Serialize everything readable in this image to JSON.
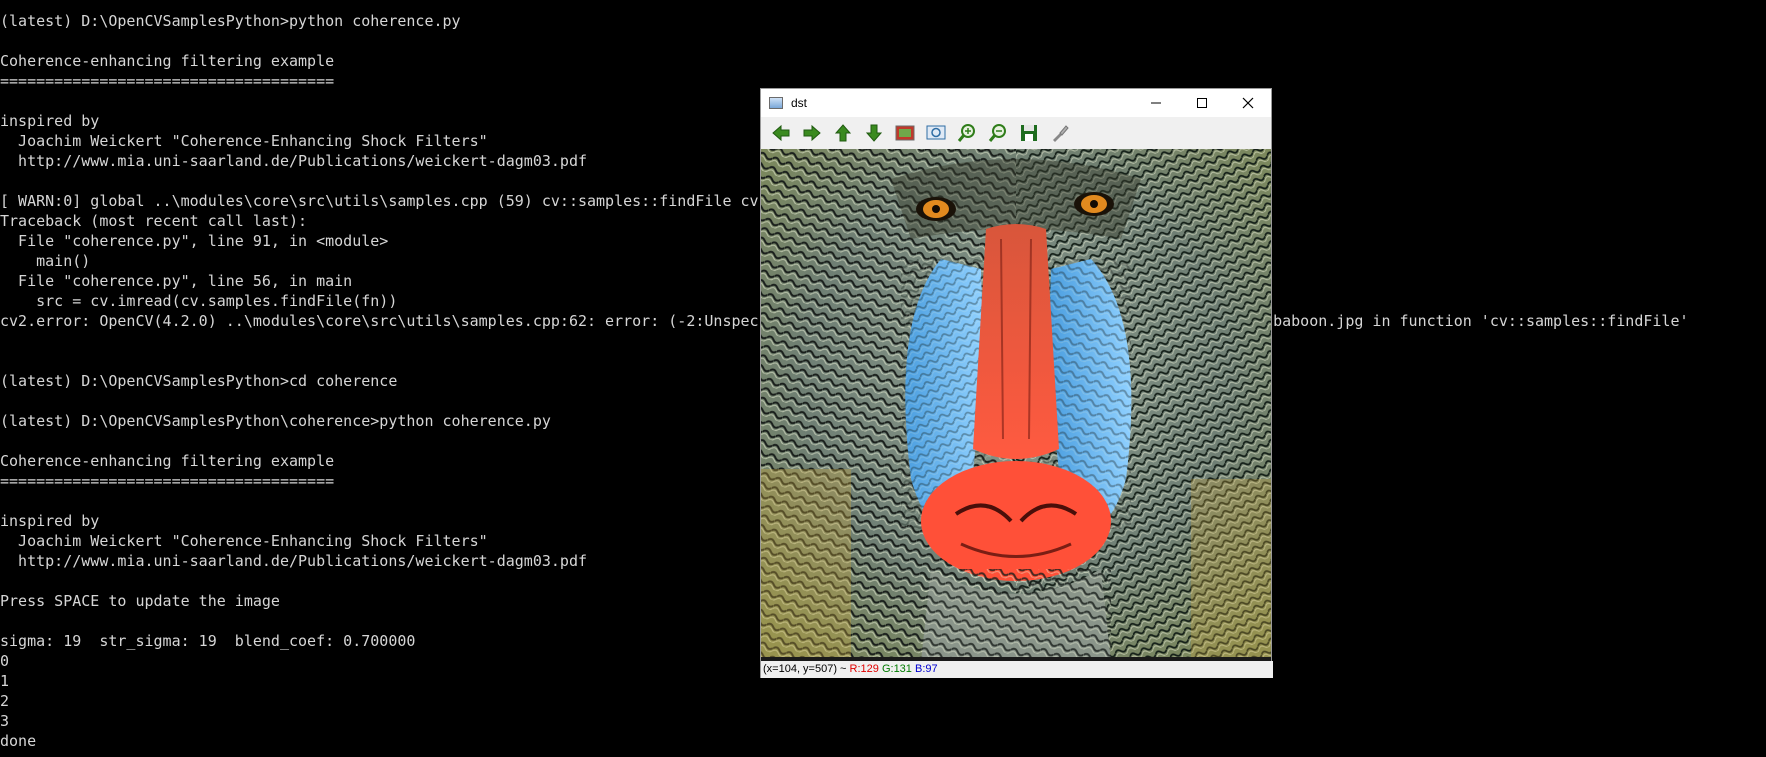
{
  "console": {
    "lines": [
      "(latest) D:\\OpenCVSamplesPython>python coherence.py",
      "",
      "Coherence-enhancing filtering example",
      "=====================================",
      "",
      "inspired by",
      "  Joachim Weickert \"Coherence-Enhancing Shock Filters\"",
      "  http://www.mia.uni-saarland.de/Publications/weickert-dagm03.pdf",
      "",
      "[ WARN:0] global ..\\modules\\core\\src\\utils\\samples.cpp (59) cv::samples::findFile cv",
      "Traceback (most recent call last):",
      "  File \"coherence.py\", line 91, in <module>",
      "    main()",
      "  File \"coherence.py\", line 56, in main",
      "    src = cv.imread(cv.samples.findFile(fn))",
      "cv2.error: OpenCV(4.2.0) ..\\modules\\core\\src\\utils\\samples.cpp:62: error: (-2:Unspec",
      "",
      "",
      "(latest) D:\\OpenCVSamplesPython>cd coherence",
      "",
      "(latest) D:\\OpenCVSamplesPython\\coherence>python coherence.py",
      "",
      "Coherence-enhancing filtering example",
      "=====================================",
      "",
      "inspired by",
      "  Joachim Weickert \"Coherence-Enhancing Shock Filters\"",
      "  http://www.mia.uni-saarland.de/Publications/weickert-dagm03.pdf",
      "",
      "Press SPACE to update the image",
      "",
      "sigma: 19  str_sigma: 19  blend_coef: 0.700000",
      "0",
      "1",
      "2",
      "3",
      "done"
    ],
    "error_tail": "e: baboon.jpg in function 'cv::samples::findFile'"
  },
  "window": {
    "title": "dst",
    "toolbar": [
      {
        "name": "pan-left-icon",
        "color": "#3a8a1f"
      },
      {
        "name": "pan-right-icon",
        "color": "#3a8a1f"
      },
      {
        "name": "pan-up-icon",
        "color": "#3a8a1f"
      },
      {
        "name": "pan-down-icon",
        "color": "#3a8a1f"
      },
      {
        "name": "zoom-reset-icon",
        "color": "#c0392b"
      },
      {
        "name": "zoom-fit-icon",
        "color": "#2e6da4"
      },
      {
        "name": "zoom-in-icon",
        "color": "#2f7d1a"
      },
      {
        "name": "zoom-out-icon",
        "color": "#2f7d1a"
      },
      {
        "name": "save-icon",
        "color": "#1f6d1f"
      },
      {
        "name": "properties-icon",
        "color": "#888888"
      }
    ],
    "status": {
      "coords": "(x=104, y=507) ~ ",
      "r": "R:129",
      "g": "G:131",
      "b": "B:97"
    }
  }
}
